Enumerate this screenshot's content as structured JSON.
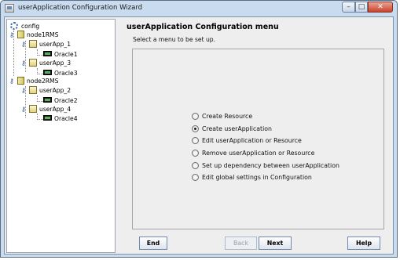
{
  "window": {
    "title": "userApplication Configuration Wizard",
    "controls": {
      "minimize": "–",
      "maximize": "□",
      "close": "✕"
    }
  },
  "tree": {
    "root": "config",
    "hosts": [
      {
        "label": "node1RMS",
        "apps": [
          {
            "label": "userApp_1",
            "resource": "Oracle1"
          },
          {
            "label": "userApp_3",
            "resource": "Oracle3"
          }
        ]
      },
      {
        "label": "node2RMS",
        "apps": [
          {
            "label": "userApp_2",
            "resource": "Oracle2"
          },
          {
            "label": "userApp_4",
            "resource": "Oracle4"
          }
        ]
      }
    ]
  },
  "panel": {
    "title": "userApplication Configuration menu",
    "subtitle": "Select a menu to be set up.",
    "options": [
      {
        "label": "Create Resource",
        "checked": false
      },
      {
        "label": "Create userApplication",
        "checked": true
      },
      {
        "label": "Edit userApplication or Resource",
        "checked": false
      },
      {
        "label": "Remove userApplication or Resource",
        "checked": false
      },
      {
        "label": "Set up dependency between userApplication",
        "checked": false
      },
      {
        "label": "Edit global settings in Configuration",
        "checked": false
      }
    ]
  },
  "buttons": {
    "end": "End",
    "back": "Back",
    "next": "Next",
    "help": "Help"
  },
  "icons": {
    "key": "⚷",
    "config": "config-icon",
    "host": "host-icon",
    "app": "userapp-icon",
    "resource": "resource-icon"
  }
}
